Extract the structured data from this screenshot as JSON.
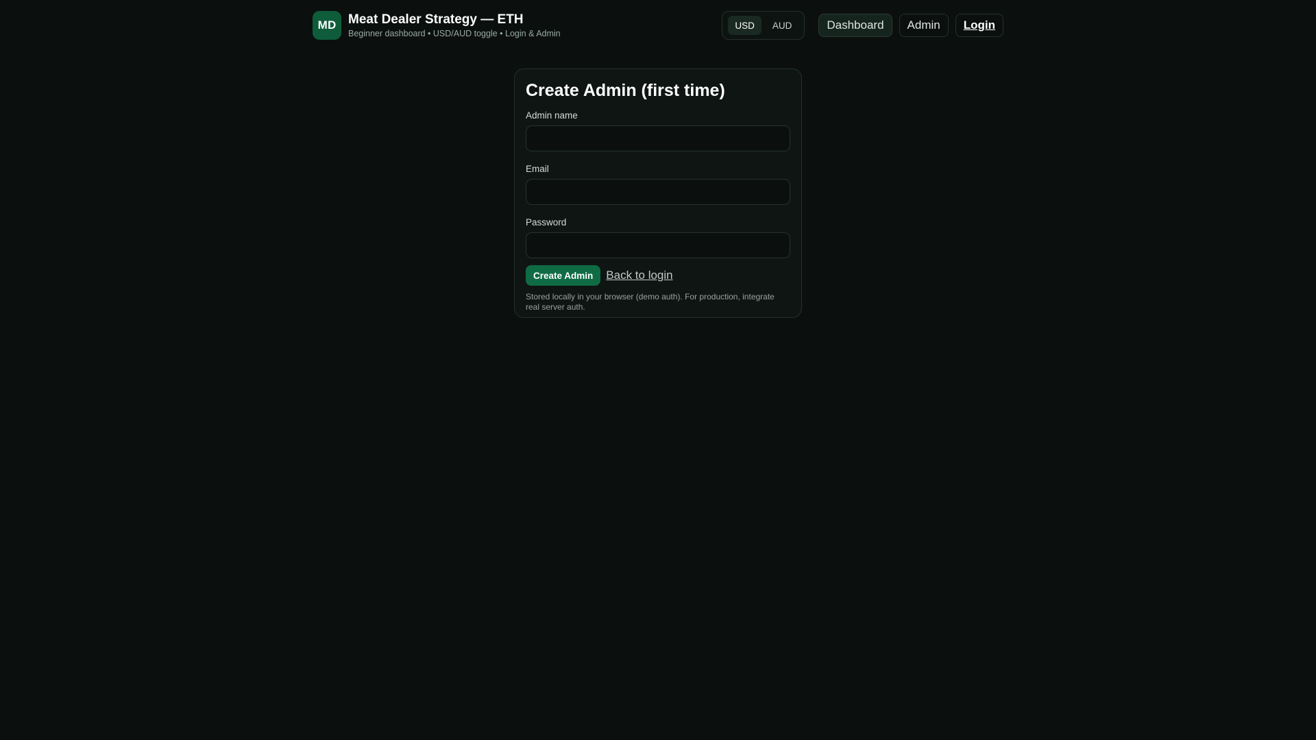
{
  "header": {
    "logo_text": "MD",
    "title": "Meat Dealer Strategy — ETH",
    "subtitle": "Beginner dashboard • USD/AUD toggle • Login & Admin"
  },
  "currency": {
    "options": [
      "USD",
      "AUD"
    ],
    "selected": "USD"
  },
  "nav": {
    "dashboard": "Dashboard",
    "admin": "Admin",
    "login": "Login"
  },
  "form": {
    "title": "Create Admin (first time)",
    "name_label": "Admin name",
    "name_value": "",
    "email_label": "Email",
    "email_value": "",
    "password_label": "Password",
    "password_value": "",
    "submit_label": "Create Admin",
    "back_label": "Back to login",
    "note": "Stored locally in your browser (demo auth). For production, integrate real server auth."
  },
  "colors": {
    "background": "#0b100f",
    "accent": "#0f6b43",
    "logo_bg": "#0f5c3b"
  }
}
